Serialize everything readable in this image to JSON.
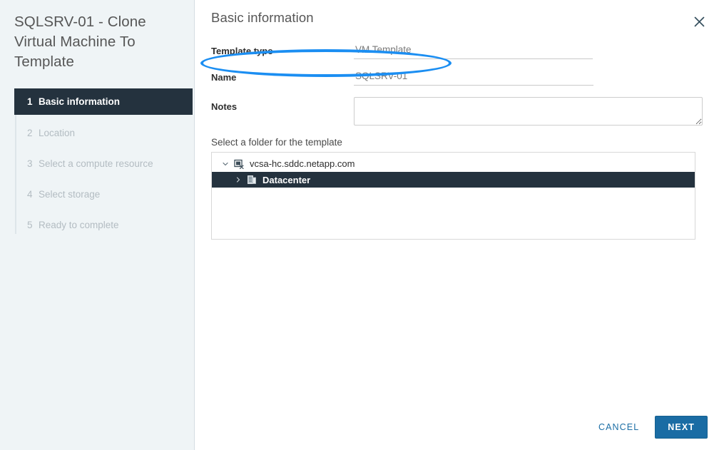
{
  "wizard": {
    "title": "SQLSRV-01 - Clone Virtual Machine To Template",
    "steps": [
      {
        "num": "1",
        "label": "Basic information"
      },
      {
        "num": "2",
        "label": "Location"
      },
      {
        "num": "3",
        "label": "Select a compute resource"
      },
      {
        "num": "4",
        "label": "Select storage"
      },
      {
        "num": "5",
        "label": "Ready to complete"
      }
    ]
  },
  "panel": {
    "header": "Basic information",
    "close_icon": "close-icon"
  },
  "form": {
    "template_type": {
      "label": "Template type",
      "value": "VM Template"
    },
    "name": {
      "label": "Name",
      "value": "SQLSRV-01",
      "placeholder": ""
    },
    "notes": {
      "label": "Notes",
      "value": "",
      "placeholder": ""
    },
    "folder": {
      "label": "Select a folder for the template",
      "nodes": [
        {
          "label": "vcsa-hc.sddc.netapp.com",
          "icon": "vcenter-icon",
          "chevron": "chevron-down-icon",
          "expanded": true,
          "selected": false
        },
        {
          "label": "Datacenter",
          "icon": "datacenter-icon",
          "chevron": "chevron-right-icon",
          "expanded": false,
          "selected": true
        }
      ]
    }
  },
  "footer": {
    "cancel_label": "CANCEL",
    "next_label": "NEXT"
  },
  "annotation": {
    "shape": "ellipse-highlight",
    "target": "Template type",
    "color": "#1b8ef2"
  },
  "colors": {
    "sidebar_bg": "#eff4f6",
    "active_step_bg": "#24323e",
    "accent_blue": "#1a6ca4",
    "annotation_blue": "#1b8ef2"
  }
}
